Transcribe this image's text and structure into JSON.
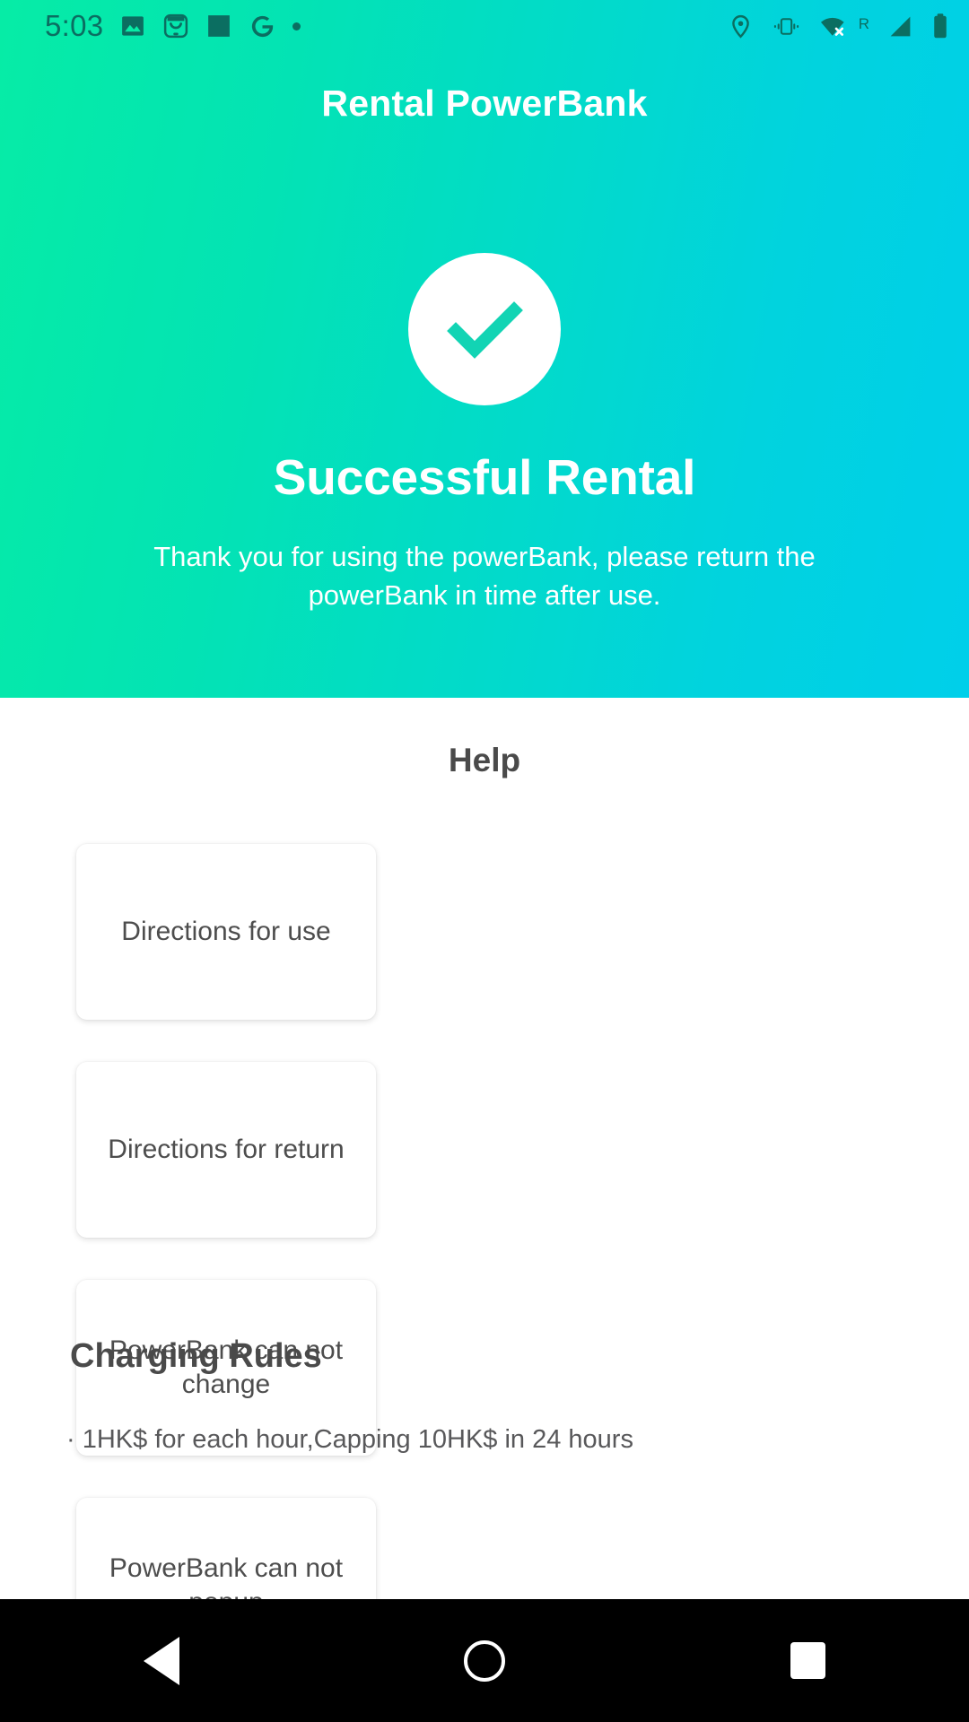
{
  "status_bar": {
    "clock": "5:03",
    "left_icons": [
      "photo-icon",
      "smiley-app-icon",
      "square-app-icon",
      "google-g-icon",
      "small-dot-icon"
    ],
    "right_icons": [
      "location-pin-icon",
      "vibrate-icon",
      "wifi-disconnected-icon",
      "roaming-indicator",
      "cell-signal-icon",
      "battery-icon"
    ],
    "roaming_label": "R"
  },
  "header": {
    "app_title": "Rental PowerBank"
  },
  "hero": {
    "status_icon": "check-circle-icon",
    "title": "Successful Rental",
    "subtitle": "Thank you for using the powerBank, please return the powerBank in time after use."
  },
  "help": {
    "section_title": "Help",
    "cards": [
      {
        "label": "Directions for use"
      },
      {
        "label": "Directions for return"
      },
      {
        "label": "PowerBank can not change"
      },
      {
        "label": "PowerBank can not popup"
      }
    ]
  },
  "charging_rules": {
    "section_title": "Charging Rules",
    "lines": [
      "· 1HK$ for each hour,Capping 10HK$ in 24 hours"
    ]
  },
  "nav_bar": {
    "back_label": "Back",
    "home_label": "Home",
    "recents_label": "Recent apps"
  },
  "colors": {
    "gradient_start": "#06ECA6",
    "gradient_end": "#00CFEA",
    "check_mark": "#12D4B4",
    "heading_text": "#4A4A4A",
    "card_text": "#4D4D4D",
    "status_bar_icon": "#0B6E61"
  }
}
